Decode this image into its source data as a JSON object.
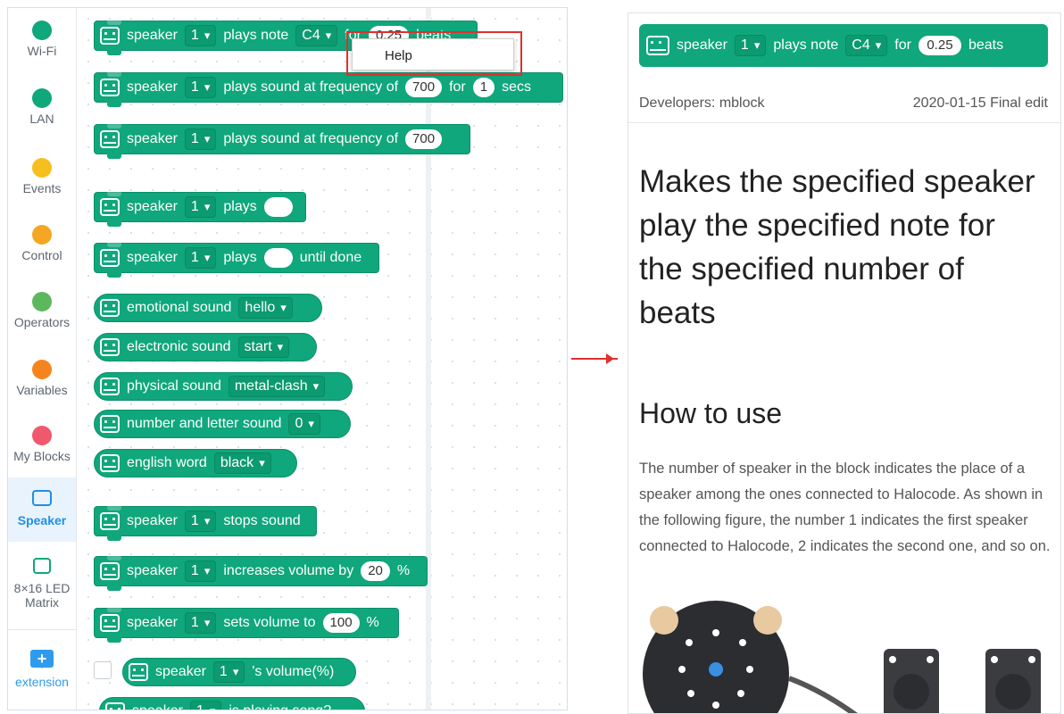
{
  "categories": [
    {
      "name": "Wi-Fi",
      "color": "#0fa77b",
      "icon": "wifi-icon"
    },
    {
      "name": "LAN",
      "color": "#0fa77b",
      "icon": "lan-icon"
    },
    {
      "name": "Events",
      "color": "#f5bf1e",
      "icon": "dot"
    },
    {
      "name": "Control",
      "color": "#f5a623",
      "icon": "dot"
    },
    {
      "name": "Operators",
      "color": "#5cb85c",
      "icon": "dot"
    },
    {
      "name": "Variables",
      "color": "#f5841f",
      "icon": "dot"
    },
    {
      "name": "My Blocks",
      "color": "#f0586e",
      "icon": "dot"
    },
    {
      "name": "Speaker",
      "color": "#1f8fe6",
      "icon": "speaker-icon",
      "active": true
    },
    {
      "name": "8×16 LED",
      "name2": "Matrix",
      "color": "#0fa77b",
      "icon": "led-matrix-icon"
    }
  ],
  "extension": {
    "label": "extension",
    "icon_text": "+"
  },
  "blocks": {
    "b1": {
      "speaker": "speaker",
      "num": "1",
      "text1": "plays note",
      "note": "C4",
      "text2": "for",
      "beats_val": "0.25",
      "text3": "beats"
    },
    "b2": {
      "speaker": "speaker",
      "num": "1",
      "text1": "plays sound at frequency of",
      "val1": "700",
      "text2": "for",
      "val2": "1",
      "text3": "secs"
    },
    "b3": {
      "speaker": "speaker",
      "num": "1",
      "text1": "plays sound at frequency of",
      "val1": "700"
    },
    "b4": {
      "speaker": "speaker",
      "num": "1",
      "text1": "plays"
    },
    "b5": {
      "speaker": "speaker",
      "num": "1",
      "text1": "plays",
      "text2": "until done"
    },
    "b6": {
      "text1": "emotional sound",
      "opt": "hello"
    },
    "b7": {
      "text1": "electronic sound",
      "opt": "start"
    },
    "b8": {
      "text1": "physical sound",
      "opt": "metal-clash"
    },
    "b9": {
      "text1": "number and letter sound",
      "opt": "0"
    },
    "b10": {
      "text1": "english word",
      "opt": "black"
    },
    "b11": {
      "speaker": "speaker",
      "num": "1",
      "text1": "stops sound"
    },
    "b12": {
      "speaker": "speaker",
      "num": "1",
      "text1": "increases volume by",
      "val1": "20",
      "text2": "%"
    },
    "b13": {
      "speaker": "speaker",
      "num": "1",
      "text1": "sets volume to",
      "val1": "100",
      "text2": "%"
    },
    "b14": {
      "speaker": "speaker",
      "num": "1",
      "text1": "'s volume(%)"
    },
    "b15": {
      "speaker": "speaker",
      "num": "1",
      "text1": "is playing song?"
    }
  },
  "context_menu": {
    "help": "Help"
  },
  "doc": {
    "block": {
      "speaker": "speaker",
      "num": "1",
      "text1": "plays note",
      "note": "C4",
      "text2": "for",
      "val": "0.25",
      "text3": "beats"
    },
    "developers": "Developers: mblock",
    "edit_date": "2020-01-15 Final edit",
    "title": "Makes the specified speaker play the specified note for the specified number of beats",
    "how_to_use": "How to use",
    "description": "The number of speaker in the block indicates the place of a speaker among the ones connected to Halocode. As shown in the following figure, the number 1 indicates the first speaker connected to Halocode, 2 indicates the second one, and so on."
  },
  "colors": {
    "block_green": "#0fa77b",
    "accent_blue": "#1f8fe6",
    "highlight_red": "#e0302c"
  }
}
